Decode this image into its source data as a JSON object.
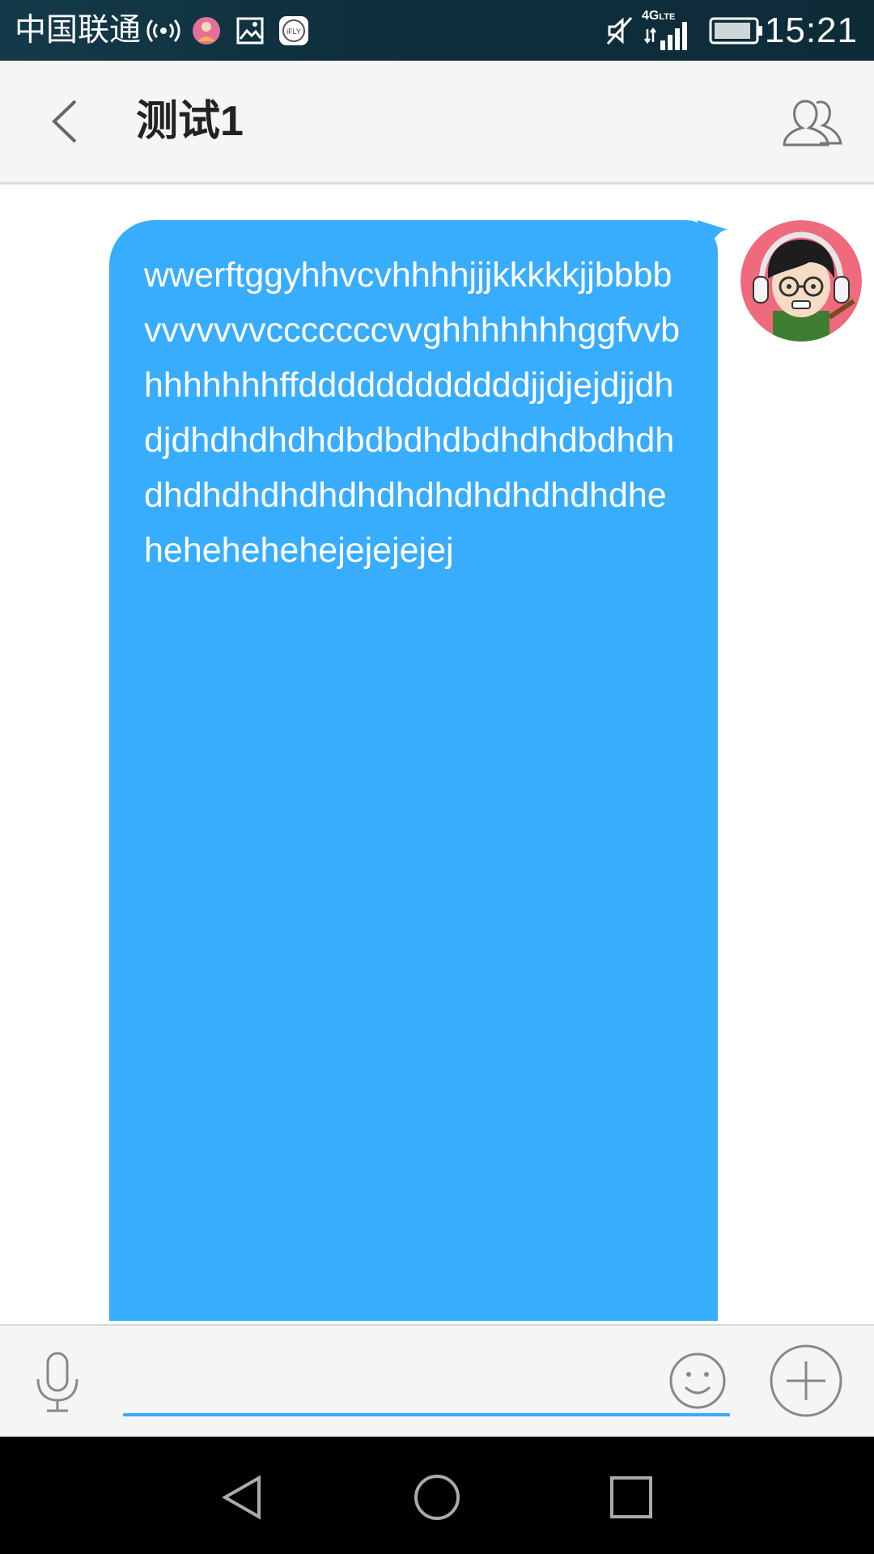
{
  "status_bar": {
    "carrier": "中国联通",
    "network": "4G",
    "network_sub": "LTE",
    "time": "15:21",
    "icons": [
      "hotspot-icon",
      "app-notification-icon",
      "gallery-icon",
      "ifly-icon",
      "mute-icon",
      "signal-icon",
      "battery-icon"
    ],
    "ifly_label": "iFLY"
  },
  "header": {
    "title": "测试1",
    "back_icon": "chevron-left-icon",
    "group_icon": "group-members-icon"
  },
  "messages": [
    {
      "sender": "self",
      "text": "wwerftggyhhvcvhhhhjjjkkkkkjjbbbbvvvvvvvcccccccvvghhhhhhhggfvvbhhhhhhhffddddddddddddjjdjejdjjdhdjdhdhdhdhdbdbdhdbdhdhdbdhdhdhdhdhdhdhdhdhdhdhdhdhdhdhehehehehehejejejejej"
    }
  ],
  "input_bar": {
    "value": "",
    "placeholder": ""
  },
  "colors": {
    "accent": "#39adfd",
    "status_bar": "#12323f",
    "header_bg": "#f5f5f5"
  }
}
